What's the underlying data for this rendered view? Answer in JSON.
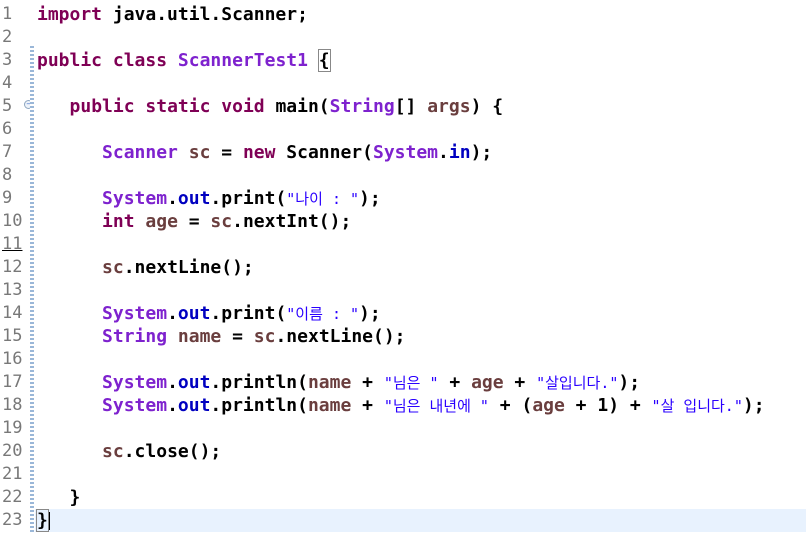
{
  "line_numbers": [
    "1",
    "2",
    "3",
    "4",
    "5",
    "6",
    "7",
    "8",
    "9",
    "10",
    "11",
    "12",
    "13",
    "14",
    "15",
    "16",
    "17",
    "18",
    "19",
    "20",
    "21",
    "22",
    "23"
  ],
  "code": {
    "l1": {
      "kw": "import",
      "rest": " java.util.Scanner;"
    },
    "l3": {
      "kw1": "public",
      "kw2": "class",
      "cls": "ScannerTest1",
      "brace": "{"
    },
    "l5": {
      "kw1": "public",
      "kw2": "static",
      "kw3": "void",
      "name": " main(",
      "type": "String",
      "mid": "[] ",
      "param": "args",
      "end": ") {"
    },
    "l7": {
      "type": "Scanner",
      "var": "sc",
      "eq": " = ",
      "kw": "new",
      "ctor": " Scanner(",
      "sys": "System",
      "dot": ".",
      "fld": "in",
      "end": ");"
    },
    "l9": {
      "sys": "System",
      "dot": ".",
      "fld": "out",
      "call": ".print(",
      "str": "\"나이 : \"",
      "end": ");"
    },
    "l10": {
      "kw": "int",
      "var": "age",
      "eq": " = ",
      "obj": "sc",
      "call": ".nextInt();"
    },
    "l12": {
      "obj": "sc",
      "call": ".nextLine();"
    },
    "l14": {
      "sys": "System",
      "dot": ".",
      "fld": "out",
      "call": ".print(",
      "str": "\"이름 : \"",
      "end": ");"
    },
    "l15": {
      "type": "String",
      "var": "name",
      "eq": " = ",
      "obj": "sc",
      "call": ".nextLine();"
    },
    "l17": {
      "sys": "System",
      "dot": ".",
      "fld": "out",
      "call": ".println(",
      "v1": "name",
      "p1": " + ",
      "s1": "\"님은 \"",
      "p2": " + ",
      "v2": "age",
      "p3": " + ",
      "s2": "\"살입니다.\"",
      "end": ");"
    },
    "l18": {
      "sys": "System",
      "dot": ".",
      "fld": "out",
      "call": ".println(",
      "v1": "name",
      "p1": " + ",
      "s1": "\"님은 내년에 \"",
      "p2": " + (",
      "v2": "age",
      "p3": " + 1) + ",
      "s2": "\"살 입니다.\"",
      "end": ");"
    },
    "l20": {
      "obj": "sc",
      "call": ".close();"
    },
    "l22": {
      "brace": "}"
    },
    "l23": {
      "brace": "}"
    }
  },
  "colors": {
    "keyword": "#7f0055",
    "class": "#7e22ce",
    "field": "#0000c0",
    "local": "#6a3e3e",
    "string": "#2a00ff",
    "current_line": "#e8f2fe"
  }
}
